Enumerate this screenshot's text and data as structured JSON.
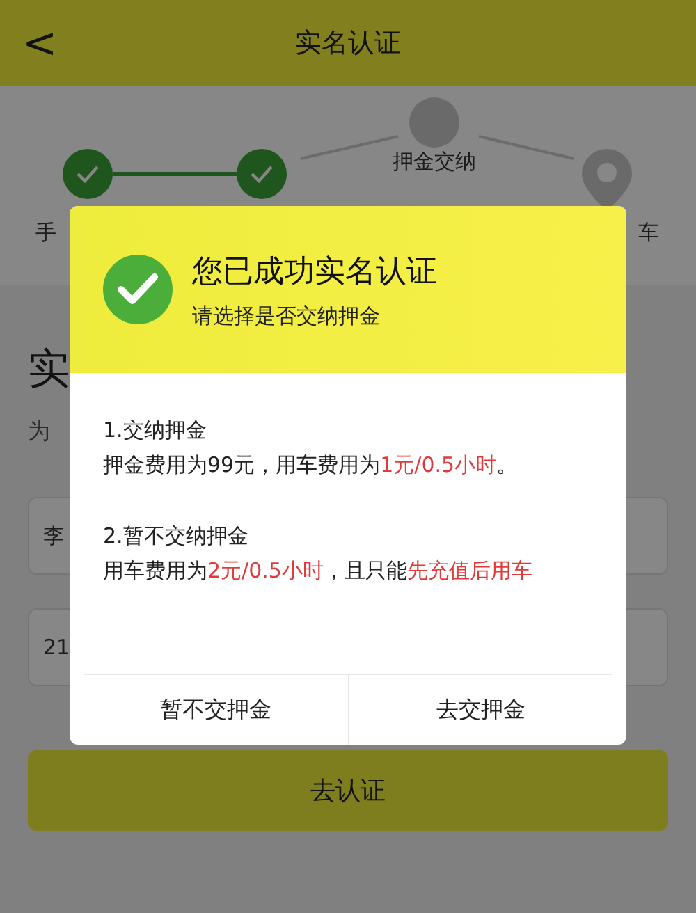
{
  "header": {
    "back": "<",
    "title": "实名认证"
  },
  "steps": [
    {
      "label": "手",
      "done": true
    },
    {
      "done": true
    },
    {
      "label": "押金交纳",
      "done": false
    },
    {
      "label": "车",
      "done": false,
      "kind": "pin"
    }
  ],
  "page": {
    "heading": "实",
    "subtitle": "为",
    "fields": [
      {
        "value": "李"
      },
      {
        "value": "21"
      }
    ],
    "submit": "去认证"
  },
  "dialog": {
    "title": "您已成功实名认证",
    "subtitle": "请选择是否交纳押金",
    "options": [
      {
        "heading": "1.交纳押金",
        "detail": [
          {
            "text": "押金费用为99元，用车费用为",
            "highlight": false
          },
          {
            "text": "1元/0.5小时",
            "highlight": true
          },
          {
            "text": "。",
            "highlight": false
          }
        ]
      },
      {
        "heading": "2.暂不交纳押金",
        "detail": [
          {
            "text": "用车费用为",
            "highlight": false
          },
          {
            "text": "2元/0.5小时",
            "highlight": true
          },
          {
            "text": "，且只能",
            "highlight": false
          },
          {
            "text": "先充值后用车",
            "highlight": true
          }
        ]
      }
    ],
    "buttons": [
      "暂不交押金",
      "去交押金"
    ]
  }
}
